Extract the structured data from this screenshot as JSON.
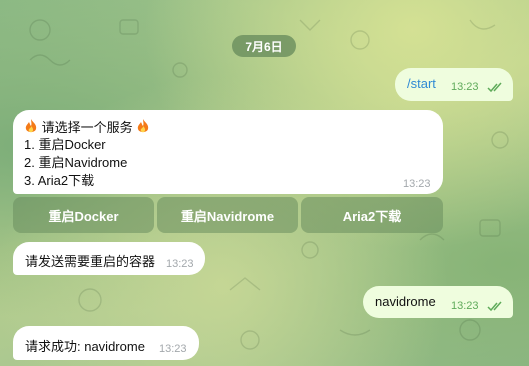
{
  "date_chip": "7月6日",
  "messages": [
    {
      "text": "/start",
      "time": "13:23"
    },
    {
      "lines": [
        "请选择一个服务",
        "1. 重启Docker",
        "2. 重启Navidrome",
        "3. Aria2下载"
      ],
      "time": "13:23"
    },
    {
      "text": "请发送需要重启的容器",
      "time": "13:23"
    },
    {
      "text": "navidrome",
      "time": "13:23"
    },
    {
      "text": "请求成功: navidrome",
      "time": "13:23"
    }
  ],
  "keyboard": [
    "重启Docker",
    "重启Navidrome",
    "Aria2下载"
  ],
  "colors": {
    "outgoing_bubble": "#effdde",
    "incoming_bubble": "#ffffff",
    "command_link": "#2f8ad4",
    "read_checks": "#5fab5a"
  },
  "icons": [
    "fire-icon",
    "double-check-icon"
  ]
}
